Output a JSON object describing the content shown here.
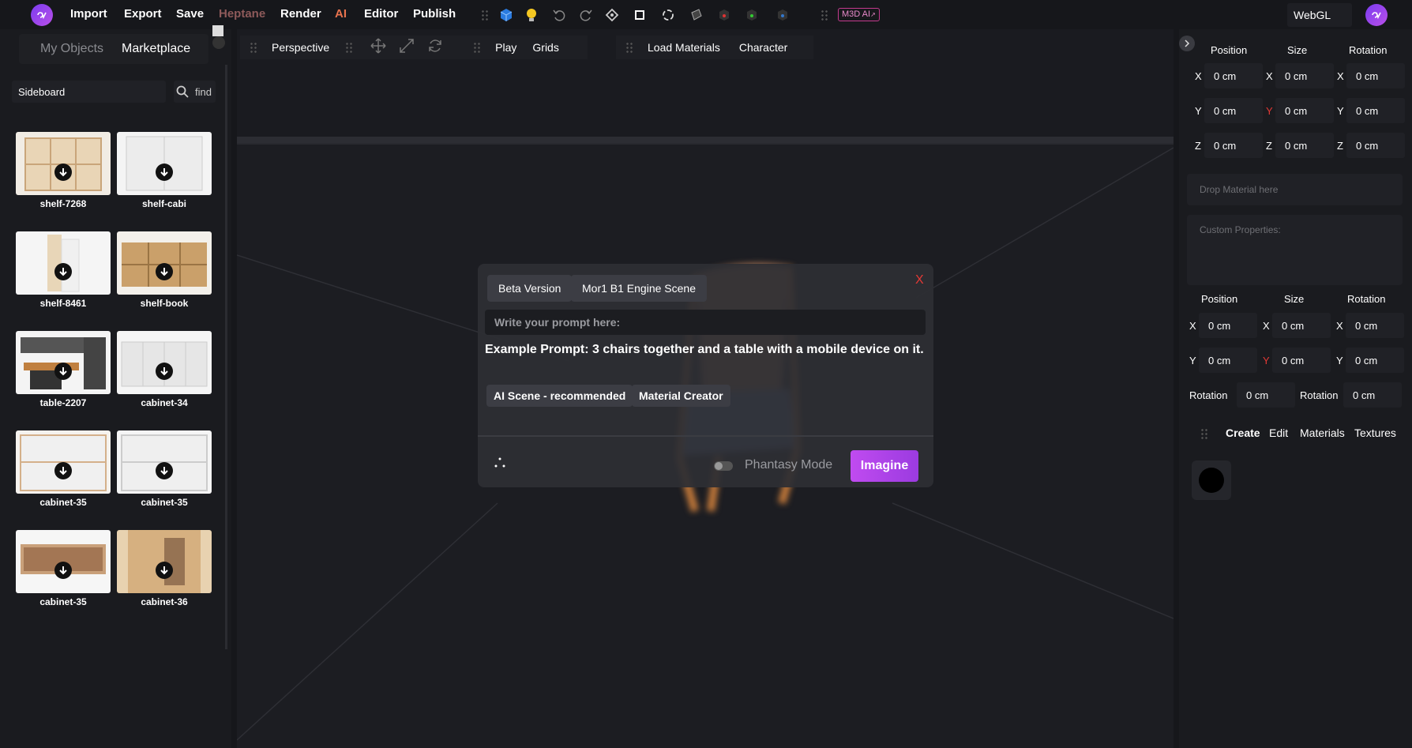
{
  "topbar": {
    "menu": [
      "Import",
      "Export",
      "Save",
      "Heptane",
      "Render",
      "AI",
      "Editor",
      "Publish"
    ],
    "ai_badge": "M3D AI",
    "engine": "WebGL",
    "colors": {
      "heptane": "#8e5a5a",
      "ai": "#e8734e",
      "accent": "#a44be6"
    }
  },
  "left": {
    "tabs": [
      "My Objects",
      "Marketplace"
    ],
    "search_value": "Sideboard",
    "find_label": "find",
    "items": [
      {
        "label": "shelf-7268"
      },
      {
        "label": "shelf-cabi"
      },
      {
        "label": "shelf-8461"
      },
      {
        "label": "shelf-book"
      },
      {
        "label": "table-2207"
      },
      {
        "label": "cabinet-34"
      },
      {
        "label": "cabinet-35"
      },
      {
        "label": "cabinet-35"
      },
      {
        "label": "cabinet-35"
      },
      {
        "label": "cabinet-36"
      }
    ]
  },
  "viewport": {
    "camera": "Perspective",
    "play": "Play",
    "grids": "Grids",
    "load_materials": "Load Materials",
    "character": "Character"
  },
  "modal": {
    "tabs": [
      "Beta Version",
      "Mor1 B1 Engine Scene"
    ],
    "close": "X",
    "prompt_placeholder": "Write your prompt here:",
    "example": "Example Prompt: 3 chairs together and a table with a mobile device on it.",
    "modes": [
      "AI Scene - recommended",
      "Material Creator"
    ],
    "phantasy": "Phantasy Mode",
    "imagine": "Imagine"
  },
  "right": {
    "headers": [
      "Position",
      "Size",
      "Rotation"
    ],
    "axes": [
      "X",
      "Y",
      "Z"
    ],
    "value": "0 cm",
    "drop_material": "Drop Material here",
    "custom_properties": "Custom Properties:",
    "rotation_label": "Rotation",
    "tabs": [
      "Create",
      "Edit",
      "Materials",
      "Textures"
    ]
  }
}
